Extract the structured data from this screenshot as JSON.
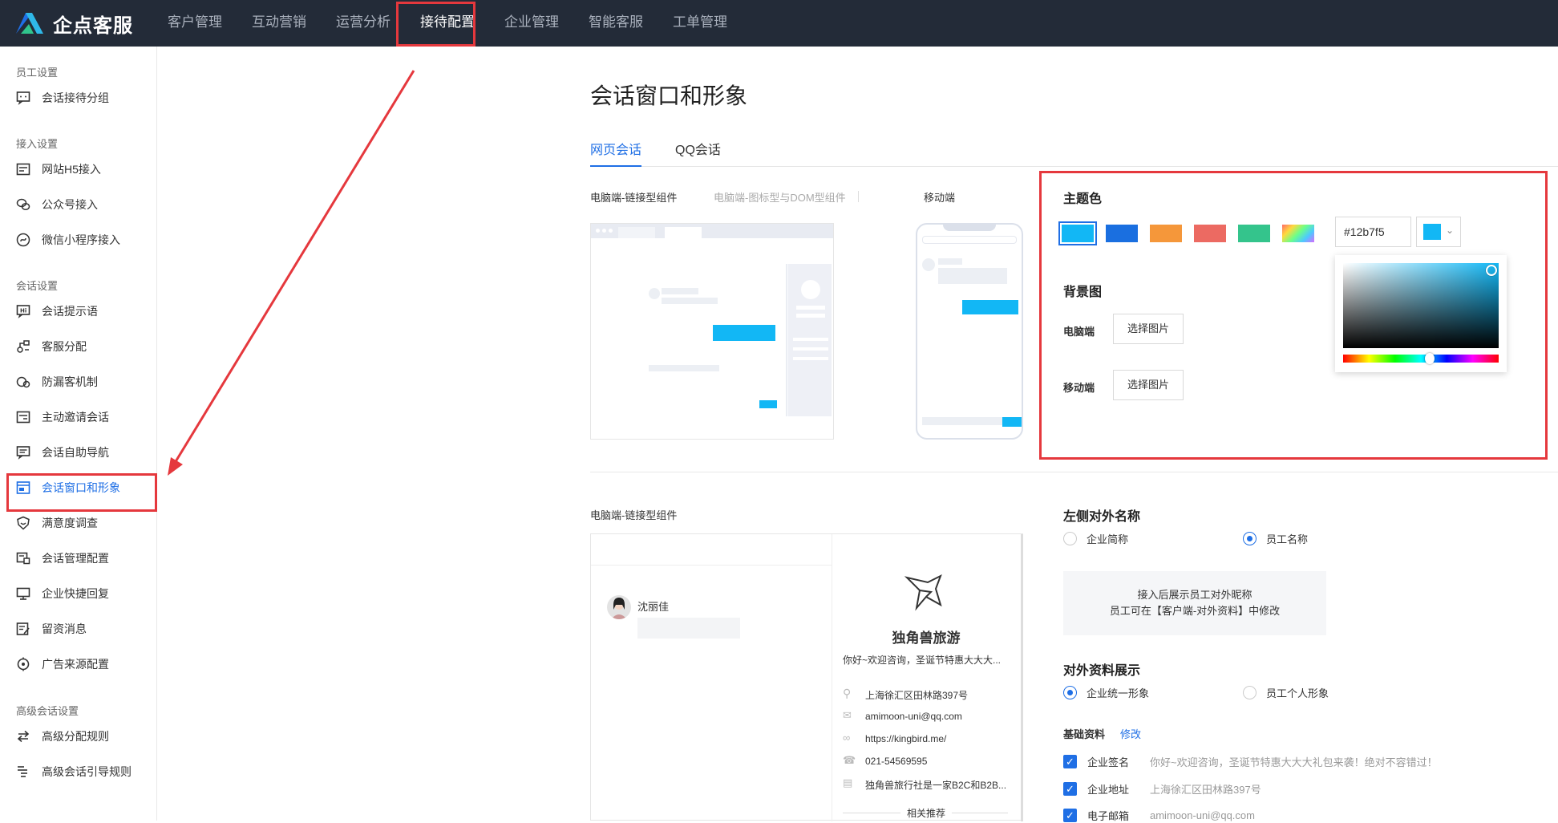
{
  "app": {
    "logo_text": "企点客服"
  },
  "nav": [
    {
      "label": "客户管理"
    },
    {
      "label": "互动营销"
    },
    {
      "label": "运营分析"
    },
    {
      "label": "接待配置"
    },
    {
      "label": "企业管理"
    },
    {
      "label": "智能客服"
    },
    {
      "label": "工单管理"
    }
  ],
  "sidebar": {
    "groups": [
      "员工设置",
      "接入设置",
      "会话设置",
      "高级会话设置"
    ],
    "items": [
      {
        "label": "会话接待分组"
      },
      {
        "label": "网站H5接入"
      },
      {
        "label": "公众号接入"
      },
      {
        "label": "微信小程序接入"
      },
      {
        "label": "会话提示语"
      },
      {
        "label": "客服分配"
      },
      {
        "label": "防漏客机制"
      },
      {
        "label": "主动邀请会话"
      },
      {
        "label": "会话自助导航"
      },
      {
        "label": "会话窗口和形象"
      },
      {
        "label": "满意度调查"
      },
      {
        "label": "会话管理配置"
      },
      {
        "label": "企业快捷回复"
      },
      {
        "label": "留资消息"
      },
      {
        "label": "广告来源配置"
      },
      {
        "label": "高级分配规则"
      },
      {
        "label": "高级会话引导规则"
      }
    ]
  },
  "page": {
    "title": "会话窗口和形象",
    "tabs": [
      "网页会话",
      "QQ会话"
    ],
    "sub_tabs": [
      "电脑端-链接型组件",
      "电脑端-图标型与DOM型组件",
      "移动端"
    ]
  },
  "theme": {
    "title": "主题色",
    "swatches": [
      "#12b7f5",
      "#1a6fe0",
      "#f5973a",
      "#ec6a62",
      "#34c48c",
      "rainbow"
    ],
    "hex_value": "#12b7f5",
    "current_color": "#12b7f5"
  },
  "background": {
    "title": "背景图",
    "pc_label": "电脑端",
    "mobile_label": "移动端",
    "choose_btn": "选择图片"
  },
  "lower": {
    "preview_label": "电脑端-链接型组件",
    "contact_name": "沈丽佳",
    "company_name": "独角兽旅游",
    "greeting": "你好~欢迎咨询，圣诞节特惠大大大...",
    "address": "上海徐汇区田林路397号",
    "email": "amimoon-uni@qq.com",
    "website": "https://kingbird.me/",
    "phone": "021-54569595",
    "intro": "独角兽旅行社是一家B2C和B2B...",
    "related": "相关推荐"
  },
  "left_name": {
    "title": "左侧对外名称",
    "opt1": "企业简称",
    "opt2": "员工名称",
    "tip1": "接入后展示员工对外昵称",
    "tip2": "员工可在【客户端-对外资料】中修改"
  },
  "profile_display": {
    "title": "对外资料展示",
    "opt1": "企业统一形象",
    "opt2": "员工个人形象",
    "basic_label": "基础资料",
    "edit_link": "修改",
    "rows": [
      {
        "label": "企业签名",
        "value": "你好~欢迎咨询，圣诞节特惠大大大礼包来袭！绝对不容错过！"
      },
      {
        "label": "企业地址",
        "value": "上海徐汇区田林路397号"
      },
      {
        "label": "电子邮箱",
        "value": "amimoon-uni@qq.com"
      }
    ]
  }
}
